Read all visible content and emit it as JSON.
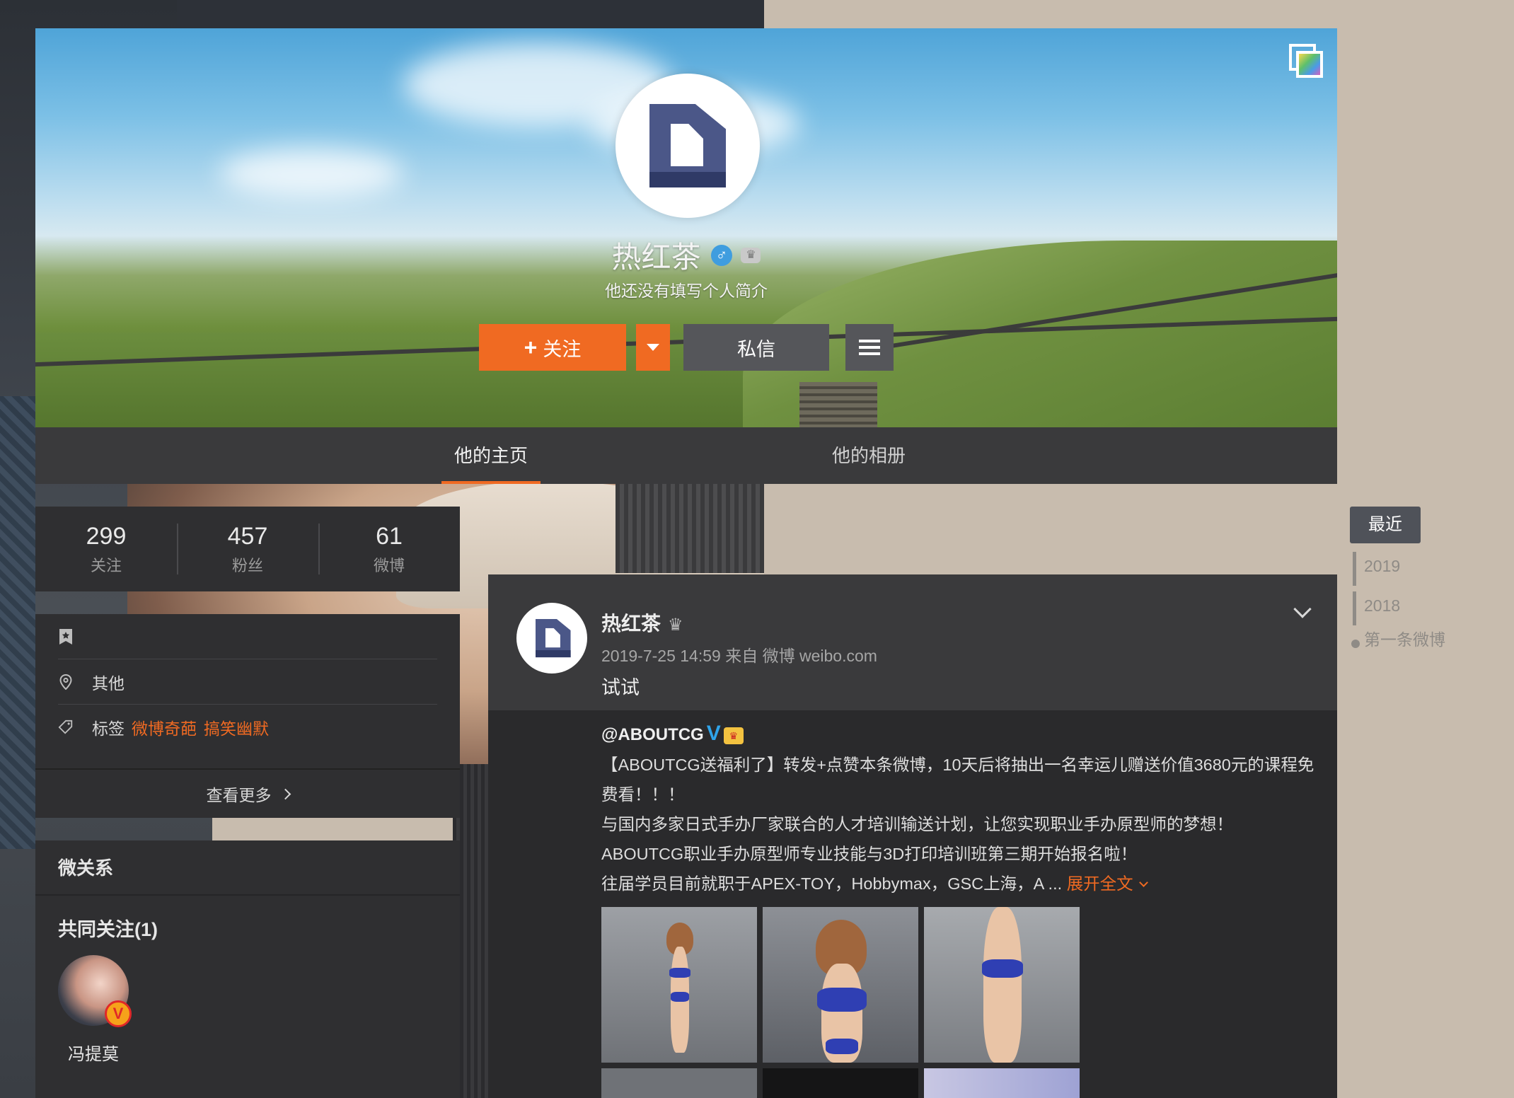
{
  "profile": {
    "name": "热红茶",
    "gender_icon": "male-icon",
    "gender_glyph": "♂",
    "member_icon_glyph": "♛",
    "bio": "他还没有填写个人简介"
  },
  "actions": {
    "follow_plus": "+",
    "follow_label": "关注",
    "message_label": "私信"
  },
  "tabs": [
    {
      "label": "他的主页",
      "active": true
    },
    {
      "label": "他的相册",
      "active": false
    }
  ],
  "stats": [
    {
      "value": "299",
      "label": "关注"
    },
    {
      "value": "457",
      "label": "粉丝"
    },
    {
      "value": "61",
      "label": "微博"
    }
  ],
  "info": {
    "location": "其他",
    "tags_label": "标签",
    "tags": [
      "微博奇葩",
      "搞笑幽默"
    ],
    "see_more": "查看更多"
  },
  "relations": {
    "title": "微关系",
    "common_follow_title": "共同关注(1)",
    "friends": [
      {
        "name": "冯提莫",
        "badge": "V"
      }
    ]
  },
  "timeline": {
    "recent": "最近",
    "years": [
      "2019",
      "2018"
    ],
    "first": "第一条微博"
  },
  "post": {
    "author": "热红茶",
    "crown_glyph": "♛",
    "time_source": "2019-7-25 14:59 来自 微博 weibo.com",
    "text": "试试",
    "repost": {
      "user": "@ABOUTCG",
      "v_badge": "V",
      "king_badge": "♛",
      "line1": "【ABOUTCG送福利了】转发+点赞本条微博，10天后将抽出一名幸运儿赠送价值3680元的课程免费看！！！",
      "line2": "与国内多家日式手办厂家联合的人才培训输送计划，让您实现职业手办原型师的梦想！",
      "line3": "ABOUTCG职业手办原型师专业技能与3D打印培训班第三期开始报名啦！",
      "line4": "往届学员目前就职于APEX-TOY，Hobbymax，GSC上海，A ...",
      "expand": "展开全文"
    }
  },
  "colors": {
    "accent": "#f06a22",
    "panel": "#2f2f31",
    "v_blue": "#2fa4ea"
  }
}
